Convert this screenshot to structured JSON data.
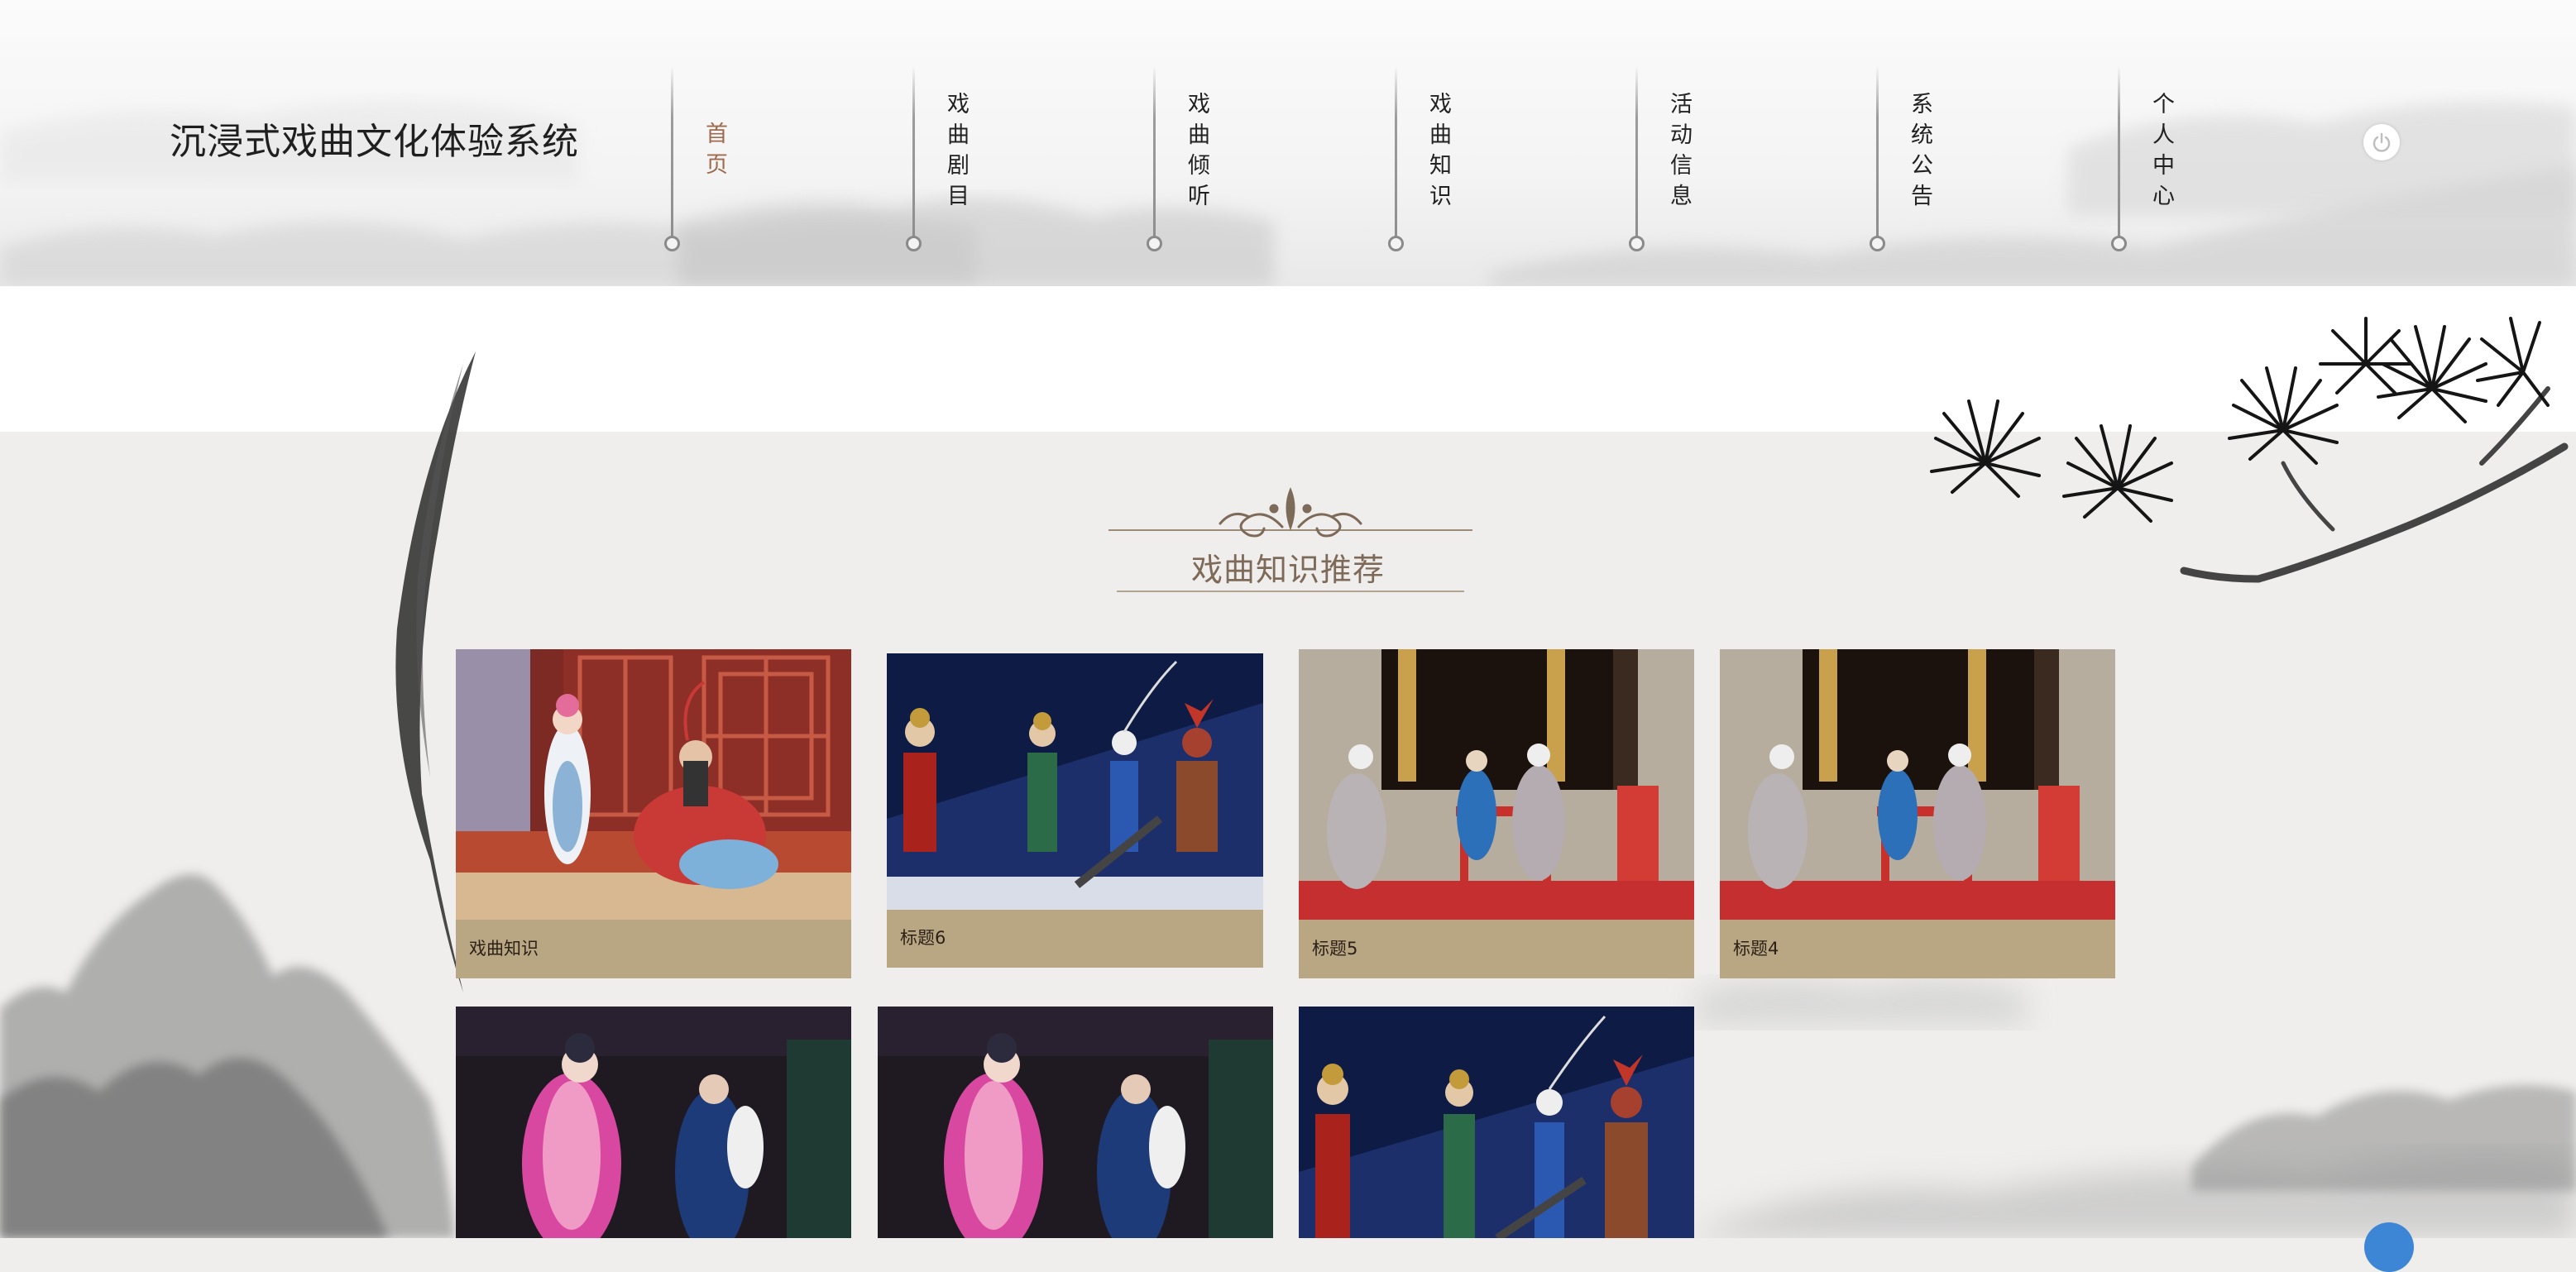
{
  "header": {
    "site_title": "沉浸式戏曲文化体验系统",
    "nav": [
      {
        "label": "首页",
        "active": true
      },
      {
        "label": "戏曲剧目",
        "active": false
      },
      {
        "label": "戏曲倾听",
        "active": false
      },
      {
        "label": "戏曲知识",
        "active": false
      },
      {
        "label": "活动信息",
        "active": false
      },
      {
        "label": "系统公告",
        "active": false
      },
      {
        "label": "个人中心",
        "active": false
      }
    ],
    "logout_icon": "power-icon"
  },
  "section": {
    "title": "戏曲知识推荐",
    "cards": [
      {
        "caption": "戏曲知识",
        "image": "opera-scene-couple-red-set"
      },
      {
        "caption": "标题6",
        "image": "opera-scene-warriors-blue-stage"
      },
      {
        "caption": "标题5",
        "image": "opera-scene-table-red-carpet"
      },
      {
        "caption": "标题4",
        "image": "opera-scene-table-red-carpet"
      },
      {
        "caption": "",
        "image": "opera-scene-pink-robe-dark-stage"
      },
      {
        "caption": "",
        "image": "opera-scene-pink-robe-dark-stage"
      },
      {
        "caption": "",
        "image": "opera-scene-warriors-blue-stage"
      }
    ]
  },
  "colors": {
    "accent_active_nav": "#a06a4e",
    "card_caption_bg": "#b9a683",
    "section_title": "#7d6a58",
    "page_bg": "#efeeec"
  }
}
